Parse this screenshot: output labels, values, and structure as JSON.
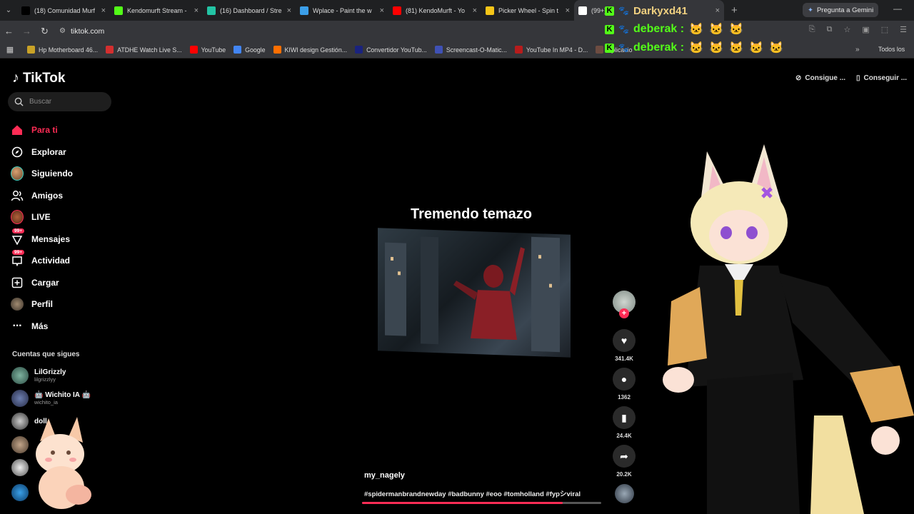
{
  "browser": {
    "tabs": [
      {
        "title": "(18) Comunidad Murf",
        "icon": "x-icon",
        "color": "#000000"
      },
      {
        "title": "Kendomurft Stream -",
        "icon": "kick-icon",
        "color": "#53fc18"
      },
      {
        "title": "(16) Dashboard / Stre",
        "icon": "streamelements-icon",
        "color": "#23c4a4"
      },
      {
        "title": "Wplace - Paint the w",
        "icon": "globe-icon",
        "color": "#3b9ee8"
      },
      {
        "title": "(81) KendoMurft - Yo",
        "icon": "youtube-icon",
        "color": "#ff0000"
      },
      {
        "title": "Picker Wheel - Spin t",
        "icon": "wheel-icon",
        "color": "#f5c518"
      },
      {
        "title": "(99+) d",
        "icon": "tiktok-icon",
        "color": "#ffffff"
      }
    ],
    "gemini_label": "Pregunta a Gemini",
    "url": "tiktok.com",
    "bookmarks": [
      {
        "label": "Hp Motherboard 46...",
        "color": "#c9a227"
      },
      {
        "label": "ATDHE Watch Live S...",
        "color": "#d32f2f"
      },
      {
        "label": "YouTube",
        "color": "#ff0000"
      },
      {
        "label": "Google",
        "color": "#4285f4"
      },
      {
        "label": "KIWI design Gestión...",
        "color": "#ff6f00"
      },
      {
        "label": "Convertidor YouTub...",
        "color": "#1a237e"
      },
      {
        "label": "Screencast-O-Matic...",
        "color": "#3f51b5"
      },
      {
        "label": "YouTube In MP4 - D...",
        "color": "#b71c1c"
      },
      {
        "label": "Aplicacio",
        "color": "#6d4c41"
      }
    ],
    "bookmarks_all": "Todos los"
  },
  "chat": [
    {
      "user": "Darkyxd41",
      "text": ""
    },
    {
      "user": "deberak :",
      "text": ""
    },
    {
      "user": "deberak :",
      "text": ""
    }
  ],
  "tiktok": {
    "logo": "TikTok",
    "search_placeholder": "Buscar",
    "nav": [
      {
        "label": "Para ti",
        "icon": "home-icon"
      },
      {
        "label": "Explorar",
        "icon": "compass-icon"
      },
      {
        "label": "Siguiendo",
        "icon": "following-avatar-icon"
      },
      {
        "label": "Amigos",
        "icon": "friends-icon"
      },
      {
        "label": "LIVE",
        "icon": "live-avatar-icon"
      },
      {
        "label": "Mensajes",
        "icon": "message-icon",
        "badge": "99+"
      },
      {
        "label": "Actividad",
        "icon": "activity-icon",
        "badge": "99+"
      },
      {
        "label": "Cargar",
        "icon": "upload-icon"
      },
      {
        "label": "Perfil",
        "icon": "profile-avatar-icon"
      },
      {
        "label": "Más",
        "icon": "more-icon"
      }
    ],
    "following_header": "Cuentas que sigues",
    "following": [
      {
        "name": "LilGrizzly",
        "handle": "lilgrizzlyy"
      },
      {
        "name": "Wichito IA",
        "handle": "wichito_ia"
      },
      {
        "name": "doll",
        "handle": ""
      }
    ],
    "top_right": {
      "get_coins": "Consigue ...",
      "get_app": "Conseguir ..."
    },
    "video": {
      "caption": "Tremendo temazo",
      "author": "my_nagely",
      "hashtags": "#spidermanbrandnewday #badbunny #eoo #tomholland #fypシviral",
      "likes": "341.4K",
      "comments": "1362",
      "saves": "24.4K",
      "shares": "20.2K",
      "progress": 0.84
    }
  }
}
